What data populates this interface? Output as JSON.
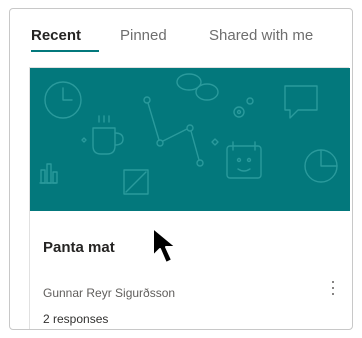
{
  "tabs": [
    {
      "label": "Recent",
      "active": true
    },
    {
      "label": "Pinned",
      "active": false
    },
    {
      "label": "Shared with me",
      "active": false
    }
  ],
  "card": {
    "title": "Panta mat",
    "owner": "Gunnar Reyr Sigurðsson",
    "responses": "2 responses",
    "banner_color": "#03787c",
    "banner_icons": [
      "clock-icon",
      "coffee-cup-icon",
      "node-graph-icon",
      "chat-bubble-icon",
      "gears-icon",
      "speech-bubble-icon",
      "bar-chart-icon",
      "checkbox-icon",
      "calendar-icon",
      "pie-chart-icon"
    ],
    "more_icon": "more-vertical-icon"
  },
  "colors": {
    "accent": "#03787c",
    "text_primary": "#252423",
    "text_secondary": "#605e5c"
  },
  "cursor_icon": "mouse-pointer-icon"
}
